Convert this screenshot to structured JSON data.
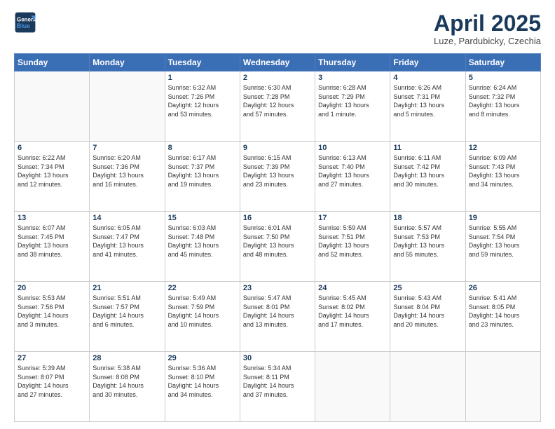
{
  "header": {
    "logo_line1": "General",
    "logo_line2": "Blue",
    "month_title": "April 2025",
    "subtitle": "Luze, Pardubicky, Czechia"
  },
  "days_of_week": [
    "Sunday",
    "Monday",
    "Tuesday",
    "Wednesday",
    "Thursday",
    "Friday",
    "Saturday"
  ],
  "weeks": [
    [
      {
        "day": "",
        "detail": ""
      },
      {
        "day": "",
        "detail": ""
      },
      {
        "day": "1",
        "detail": "Sunrise: 6:32 AM\nSunset: 7:26 PM\nDaylight: 12 hours\nand 53 minutes."
      },
      {
        "day": "2",
        "detail": "Sunrise: 6:30 AM\nSunset: 7:28 PM\nDaylight: 12 hours\nand 57 minutes."
      },
      {
        "day": "3",
        "detail": "Sunrise: 6:28 AM\nSunset: 7:29 PM\nDaylight: 13 hours\nand 1 minute."
      },
      {
        "day": "4",
        "detail": "Sunrise: 6:26 AM\nSunset: 7:31 PM\nDaylight: 13 hours\nand 5 minutes."
      },
      {
        "day": "5",
        "detail": "Sunrise: 6:24 AM\nSunset: 7:32 PM\nDaylight: 13 hours\nand 8 minutes."
      }
    ],
    [
      {
        "day": "6",
        "detail": "Sunrise: 6:22 AM\nSunset: 7:34 PM\nDaylight: 13 hours\nand 12 minutes."
      },
      {
        "day": "7",
        "detail": "Sunrise: 6:20 AM\nSunset: 7:36 PM\nDaylight: 13 hours\nand 16 minutes."
      },
      {
        "day": "8",
        "detail": "Sunrise: 6:17 AM\nSunset: 7:37 PM\nDaylight: 13 hours\nand 19 minutes."
      },
      {
        "day": "9",
        "detail": "Sunrise: 6:15 AM\nSunset: 7:39 PM\nDaylight: 13 hours\nand 23 minutes."
      },
      {
        "day": "10",
        "detail": "Sunrise: 6:13 AM\nSunset: 7:40 PM\nDaylight: 13 hours\nand 27 minutes."
      },
      {
        "day": "11",
        "detail": "Sunrise: 6:11 AM\nSunset: 7:42 PM\nDaylight: 13 hours\nand 30 minutes."
      },
      {
        "day": "12",
        "detail": "Sunrise: 6:09 AM\nSunset: 7:43 PM\nDaylight: 13 hours\nand 34 minutes."
      }
    ],
    [
      {
        "day": "13",
        "detail": "Sunrise: 6:07 AM\nSunset: 7:45 PM\nDaylight: 13 hours\nand 38 minutes."
      },
      {
        "day": "14",
        "detail": "Sunrise: 6:05 AM\nSunset: 7:47 PM\nDaylight: 13 hours\nand 41 minutes."
      },
      {
        "day": "15",
        "detail": "Sunrise: 6:03 AM\nSunset: 7:48 PM\nDaylight: 13 hours\nand 45 minutes."
      },
      {
        "day": "16",
        "detail": "Sunrise: 6:01 AM\nSunset: 7:50 PM\nDaylight: 13 hours\nand 48 minutes."
      },
      {
        "day": "17",
        "detail": "Sunrise: 5:59 AM\nSunset: 7:51 PM\nDaylight: 13 hours\nand 52 minutes."
      },
      {
        "day": "18",
        "detail": "Sunrise: 5:57 AM\nSunset: 7:53 PM\nDaylight: 13 hours\nand 55 minutes."
      },
      {
        "day": "19",
        "detail": "Sunrise: 5:55 AM\nSunset: 7:54 PM\nDaylight: 13 hours\nand 59 minutes."
      }
    ],
    [
      {
        "day": "20",
        "detail": "Sunrise: 5:53 AM\nSunset: 7:56 PM\nDaylight: 14 hours\nand 3 minutes."
      },
      {
        "day": "21",
        "detail": "Sunrise: 5:51 AM\nSunset: 7:57 PM\nDaylight: 14 hours\nand 6 minutes."
      },
      {
        "day": "22",
        "detail": "Sunrise: 5:49 AM\nSunset: 7:59 PM\nDaylight: 14 hours\nand 10 minutes."
      },
      {
        "day": "23",
        "detail": "Sunrise: 5:47 AM\nSunset: 8:01 PM\nDaylight: 14 hours\nand 13 minutes."
      },
      {
        "day": "24",
        "detail": "Sunrise: 5:45 AM\nSunset: 8:02 PM\nDaylight: 14 hours\nand 17 minutes."
      },
      {
        "day": "25",
        "detail": "Sunrise: 5:43 AM\nSunset: 8:04 PM\nDaylight: 14 hours\nand 20 minutes."
      },
      {
        "day": "26",
        "detail": "Sunrise: 5:41 AM\nSunset: 8:05 PM\nDaylight: 14 hours\nand 23 minutes."
      }
    ],
    [
      {
        "day": "27",
        "detail": "Sunrise: 5:39 AM\nSunset: 8:07 PM\nDaylight: 14 hours\nand 27 minutes."
      },
      {
        "day": "28",
        "detail": "Sunrise: 5:38 AM\nSunset: 8:08 PM\nDaylight: 14 hours\nand 30 minutes."
      },
      {
        "day": "29",
        "detail": "Sunrise: 5:36 AM\nSunset: 8:10 PM\nDaylight: 14 hours\nand 34 minutes."
      },
      {
        "day": "30",
        "detail": "Sunrise: 5:34 AM\nSunset: 8:11 PM\nDaylight: 14 hours\nand 37 minutes."
      },
      {
        "day": "",
        "detail": ""
      },
      {
        "day": "",
        "detail": ""
      },
      {
        "day": "",
        "detail": ""
      }
    ]
  ]
}
